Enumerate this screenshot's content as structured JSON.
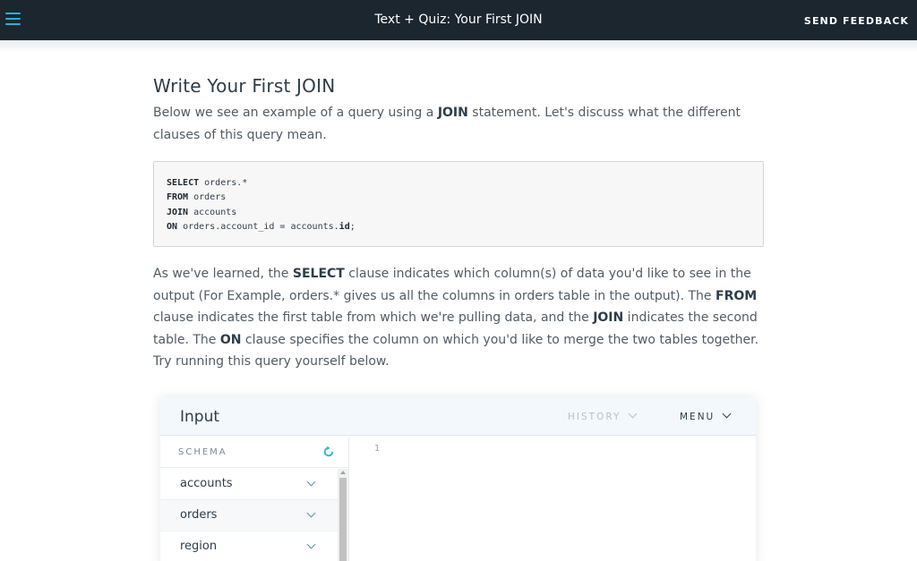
{
  "header": {
    "title": "Text + Quiz: Your First JOIN",
    "feedback_label": "SEND FEEDBACK"
  },
  "article": {
    "heading": "Write Your First JOIN",
    "intro": {
      "t1": "Below we see an example of a query using a ",
      "b1": "JOIN",
      "t2": " statement. Let's discuss what the different clauses of this query mean."
    },
    "code": [
      {
        "kw": "SELECT",
        "rest": " orders.*",
        "bold_tail": ""
      },
      {
        "kw": "FROM",
        "rest": " orders",
        "bold_tail": ""
      },
      {
        "kw": "JOIN",
        "rest": " accounts",
        "bold_tail": ""
      },
      {
        "kw": "ON",
        "rest": " orders.account_id = accounts.",
        "bold_tail": "id",
        "end": ";"
      }
    ],
    "explain": {
      "t1": "As we've learned, the ",
      "b1": "SELECT",
      "t2": " clause indicates which column(s) of data you'd like to see in the output (For Example, orders.* gives us all the columns in orders table in the output). The ",
      "b2": "FROM",
      "t3": " clause indicates the first table from which we're pulling data, and the ",
      "b3": "JOIN",
      "t4": " indicates the second table. The ",
      "b4": "ON",
      "t5": " clause specifies the column on which you'd like to merge the two tables together. Try running this query yourself below."
    }
  },
  "widget": {
    "title": "Input",
    "history_label": "HISTORY",
    "menu_label": "MENU",
    "schema_label": "SCHEMA",
    "schema_items": [
      {
        "label": "accounts"
      },
      {
        "label": "orders"
      },
      {
        "label": "region"
      }
    ],
    "line_number": "1"
  },
  "colors": {
    "topbar": "#1c262f",
    "accent": "#2ab1d4",
    "text": "#525c65",
    "heading": "#2e3d49"
  }
}
